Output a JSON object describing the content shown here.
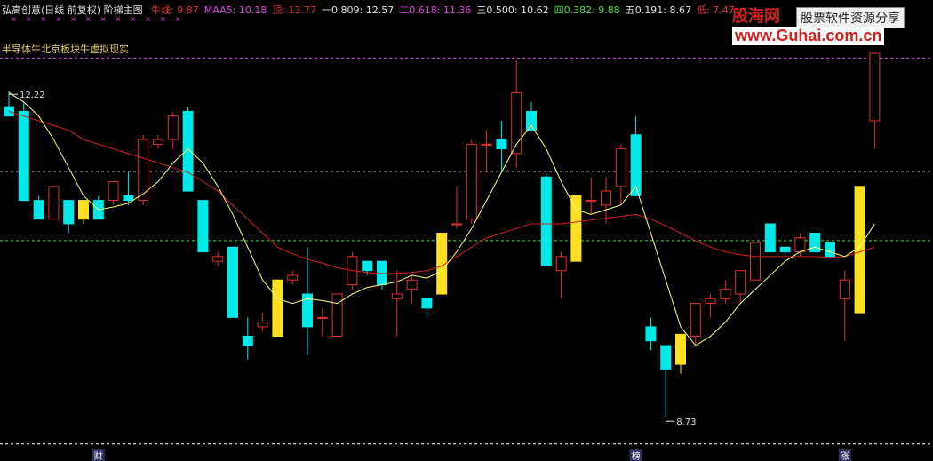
{
  "header": {
    "title": "弘高创意(日线 前复权) 阶梯主图",
    "items": [
      {
        "label": "牛线: 9.87",
        "color": "#e03030"
      },
      {
        "label": "MAA5: 10.18",
        "color": "#e040e0"
      },
      {
        "label": "顶: 13.77",
        "color": "#e03030"
      },
      {
        "label": "一0.809: 12.57",
        "color": "#e0e0e0"
      },
      {
        "label": "二0.618: 11.36",
        "color": "#e040e0"
      },
      {
        "label": "三0.500: 10.62",
        "color": "#e0e0e0"
      },
      {
        "label": "四0.382: 9.88",
        "color": "#40e040"
      },
      {
        "label": "五0.191: 8.67",
        "color": "#e0e0e0"
      },
      {
        "label": "低: 7.47",
        "color": "#e03030"
      }
    ]
  },
  "subtitle": "半导体牛北京板块牛虚拟现实",
  "watermark": {
    "logo": "股海网",
    "tag": "股票软件资源分享",
    "url": "www.Guhai.com.cn"
  },
  "chart_data": {
    "type": "candlestick",
    "ylim": [
      8.4,
      13.0
    ],
    "colors": {
      "up": "#e03030",
      "down": "#00e8e8",
      "special": "#ffe020",
      "ma_fast": "#ffff80",
      "ma_slow": "#d02020"
    },
    "levels": [
      {
        "value": 12.57,
        "color": "#e040e0",
        "style": "dashed"
      },
      {
        "value": 11.36,
        "color": "#ffffff",
        "style": "dashed"
      },
      {
        "value": 10.62,
        "color": "#40e040",
        "style": "dashed"
      },
      {
        "value": 8.45,
        "color": "#ffffff",
        "style": "dashed"
      }
    ],
    "annotations": [
      {
        "text": "12.22",
        "index": 0,
        "value": 12.22
      },
      {
        "text": "8.73",
        "index": 44,
        "value": 8.73
      }
    ],
    "bottom_labels": [
      {
        "text": "财",
        "index": 6
      },
      {
        "text": "榜",
        "index": 42
      },
      {
        "text": "涨",
        "index": 56
      }
    ],
    "candles": [
      {
        "o": 12.05,
        "h": 12.22,
        "l": 11.95,
        "c": 11.95
      },
      {
        "o": 12.0,
        "h": 12.1,
        "l": 11.05,
        "c": 11.05
      },
      {
        "o": 11.05,
        "h": 11.1,
        "l": 10.85,
        "c": 10.85
      },
      {
        "o": 10.85,
        "h": 11.2,
        "l": 10.85,
        "c": 11.2
      },
      {
        "o": 11.05,
        "h": 11.05,
        "l": 10.7,
        "c": 10.8
      },
      {
        "o": 10.85,
        "h": 11.05,
        "l": 10.8,
        "c": 11.05,
        "s": 1
      },
      {
        "o": 11.05,
        "h": 11.1,
        "l": 10.85,
        "c": 10.85
      },
      {
        "o": 11.05,
        "h": 11.25,
        "l": 11.0,
        "c": 11.25
      },
      {
        "o": 11.1,
        "h": 11.35,
        "l": 11.0,
        "c": 11.05
      },
      {
        "o": 11.05,
        "h": 11.75,
        "l": 11.0,
        "c": 11.7
      },
      {
        "o": 11.65,
        "h": 11.75,
        "l": 11.6,
        "c": 11.7
      },
      {
        "o": 11.7,
        "h": 12.0,
        "l": 11.6,
        "c": 11.95
      },
      {
        "o": 12.0,
        "h": 12.05,
        "l": 11.15,
        "c": 11.15
      },
      {
        "o": 11.05,
        "h": 11.05,
        "l": 10.5,
        "c": 10.5
      },
      {
        "o": 10.4,
        "h": 10.5,
        "l": 10.35,
        "c": 10.45
      },
      {
        "o": 10.55,
        "h": 10.55,
        "l": 9.8,
        "c": 9.8
      },
      {
        "o": 9.6,
        "h": 9.8,
        "l": 9.35,
        "c": 9.5
      },
      {
        "o": 9.7,
        "h": 9.85,
        "l": 9.65,
        "c": 9.75
      },
      {
        "o": 9.6,
        "h": 10.2,
        "l": 9.6,
        "c": 10.2,
        "s": 1
      },
      {
        "o": 10.2,
        "h": 10.3,
        "l": 10.15,
        "c": 10.25
      },
      {
        "o": 10.05,
        "h": 10.55,
        "l": 9.4,
        "c": 9.7
      },
      {
        "o": 9.8,
        "h": 9.9,
        "l": 9.6,
        "c": 9.8
      },
      {
        "o": 9.6,
        "h": 10.05,
        "l": 9.6,
        "c": 10.05
      },
      {
        "o": 10.15,
        "h": 10.5,
        "l": 10.1,
        "c": 10.45
      },
      {
        "o": 10.4,
        "h": 10.4,
        "l": 10.25,
        "c": 10.3
      },
      {
        "o": 10.4,
        "h": 10.4,
        "l": 10.1,
        "c": 10.15
      },
      {
        "o": 10.0,
        "h": 10.3,
        "l": 9.6,
        "c": 10.05
      },
      {
        "o": 10.1,
        "h": 10.25,
        "l": 9.95,
        "c": 10.2
      },
      {
        "o": 10.0,
        "h": 10.0,
        "l": 9.8,
        "c": 9.9
      },
      {
        "o": 10.05,
        "h": 10.7,
        "l": 10.05,
        "c": 10.7,
        "s": 1
      },
      {
        "o": 10.8,
        "h": 11.2,
        "l": 10.75,
        "c": 10.8
      },
      {
        "o": 10.85,
        "h": 11.7,
        "l": 10.8,
        "c": 11.65
      },
      {
        "o": 11.65,
        "h": 11.8,
        "l": 11.35,
        "c": 11.65
      },
      {
        "o": 11.7,
        "h": 11.9,
        "l": 11.35,
        "c": 11.6
      },
      {
        "o": 11.55,
        "h": 12.55,
        "l": 11.4,
        "c": 12.2
      },
      {
        "o": 12.0,
        "h": 12.1,
        "l": 11.8,
        "c": 11.8
      },
      {
        "o": 11.3,
        "h": 11.35,
        "l": 10.35,
        "c": 10.35
      },
      {
        "o": 10.3,
        "h": 10.5,
        "l": 10.0,
        "c": 10.45
      },
      {
        "o": 10.4,
        "h": 11.1,
        "l": 10.4,
        "c": 11.1,
        "s": 1
      },
      {
        "o": 11.05,
        "h": 11.3,
        "l": 10.9,
        "c": 11.05
      },
      {
        "o": 11.0,
        "h": 11.3,
        "l": 10.8,
        "c": 11.15
      },
      {
        "o": 11.2,
        "h": 11.65,
        "l": 11.0,
        "c": 11.6
      },
      {
        "o": 11.75,
        "h": 11.95,
        "l": 11.1,
        "c": 11.1
      },
      {
        "o": 9.7,
        "h": 9.8,
        "l": 9.45,
        "c": 9.55
      },
      {
        "o": 9.5,
        "h": 9.5,
        "l": 8.73,
        "c": 9.25
      },
      {
        "o": 9.3,
        "h": 9.62,
        "l": 9.2,
        "c": 9.62,
        "s": 1
      },
      {
        "o": 9.6,
        "h": 9.95,
        "l": 9.5,
        "c": 9.95
      },
      {
        "o": 9.95,
        "h": 10.05,
        "l": 9.8,
        "c": 10.0
      },
      {
        "o": 10.0,
        "h": 10.2,
        "l": 9.95,
        "c": 10.1
      },
      {
        "o": 10.05,
        "h": 10.3,
        "l": 9.95,
        "c": 10.3
      },
      {
        "o": 10.2,
        "h": 10.6,
        "l": 10.2,
        "c": 10.6
      },
      {
        "o": 10.8,
        "h": 10.8,
        "l": 10.5,
        "c": 10.5
      },
      {
        "o": 10.55,
        "h": 10.55,
        "l": 10.4,
        "c": 10.5
      },
      {
        "o": 10.5,
        "h": 10.7,
        "l": 10.45,
        "c": 10.65
      },
      {
        "o": 10.7,
        "h": 10.7,
        "l": 10.5,
        "c": 10.5
      },
      {
        "o": 10.6,
        "h": 10.6,
        "l": 10.45,
        "c": 10.45
      },
      {
        "o": 10.0,
        "h": 10.3,
        "l": 9.55,
        "c": 10.2
      },
      {
        "o": 9.85,
        "h": 11.2,
        "l": 9.85,
        "c": 11.2,
        "s": 1
      },
      {
        "o": 11.9,
        "h": 12.62,
        "l": 11.6,
        "c": 12.62
      }
    ],
    "ma_fast": [
      12.2,
      12.1,
      11.95,
      11.7,
      11.4,
      11.1,
      10.95,
      10.98,
      11.02,
      11.12,
      11.25,
      11.45,
      11.6,
      11.45,
      11.2,
      10.9,
      10.55,
      10.2,
      10.0,
      9.95,
      10.0,
      9.98,
      9.95,
      10.05,
      10.12,
      10.15,
      10.18,
      10.25,
      10.22,
      10.3,
      10.5,
      10.75,
      11.05,
      11.35,
      11.65,
      11.85,
      11.6,
      11.25,
      10.95,
      10.9,
      10.95,
      11.0,
      11.2,
      10.7,
      10.2,
      9.7,
      9.5,
      9.6,
      9.75,
      9.95,
      10.1,
      10.25,
      10.4,
      10.5,
      10.55,
      10.5,
      10.45,
      10.55,
      10.8
    ],
    "ma_slow": [
      12.0,
      11.95,
      11.9,
      11.85,
      11.8,
      11.7,
      11.65,
      11.6,
      11.55,
      11.5,
      11.45,
      11.4,
      11.35,
      11.25,
      11.15,
      11.0,
      10.85,
      10.7,
      10.55,
      10.48,
      10.42,
      10.38,
      10.33,
      10.3,
      10.28,
      10.27,
      10.27,
      10.28,
      10.3,
      10.35,
      10.45,
      10.55,
      10.65,
      10.7,
      10.75,
      10.8,
      10.8,
      10.8,
      10.82,
      10.84,
      10.86,
      10.88,
      10.9,
      10.85,
      10.78,
      10.7,
      10.62,
      10.55,
      10.5,
      10.47,
      10.45,
      10.45,
      10.45,
      10.45,
      10.45,
      10.44,
      10.45,
      10.5,
      10.55
    ]
  }
}
